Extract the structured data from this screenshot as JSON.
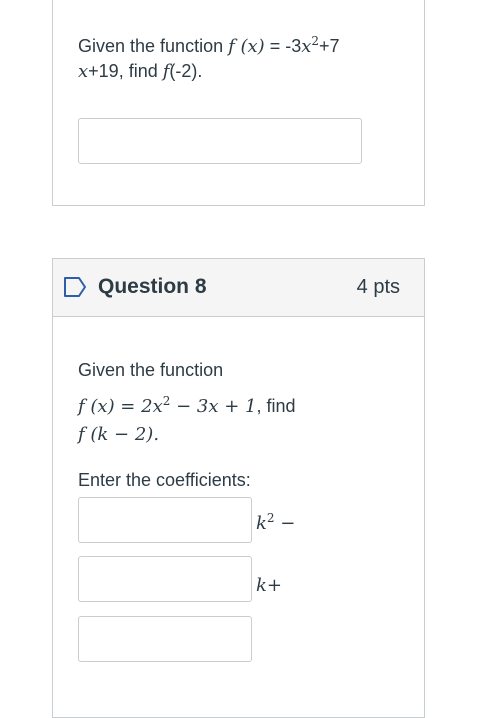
{
  "q7": {
    "line1_prefix": "Given the function ",
    "f": "f",
    "paren_x": "(x)",
    "equals_val": " = -3",
    "x1": "x",
    "exp1": "2",
    "plus7": "+7",
    "x2": "x",
    "rest2": "+19, find ",
    "f2": "f",
    "arg": "(-2)."
  },
  "q8": {
    "title": "Question 8",
    "points": "4 pts",
    "intro": "Given the function",
    "eq_f": "f",
    "eq_lhs": " (x) = 2x",
    "eq_exp": "2",
    "eq_rhs": " − 3x + 1",
    "eq_find": ", find",
    "f3": "f",
    "arg3": " (k − 2).",
    "instructions": "Enter the coefficients:",
    "unit1": "k",
    "unit1_exp": "2",
    "unit1_sign": " −",
    "unit2": "k+",
    "inputs": [
      "",
      "",
      ""
    ]
  }
}
